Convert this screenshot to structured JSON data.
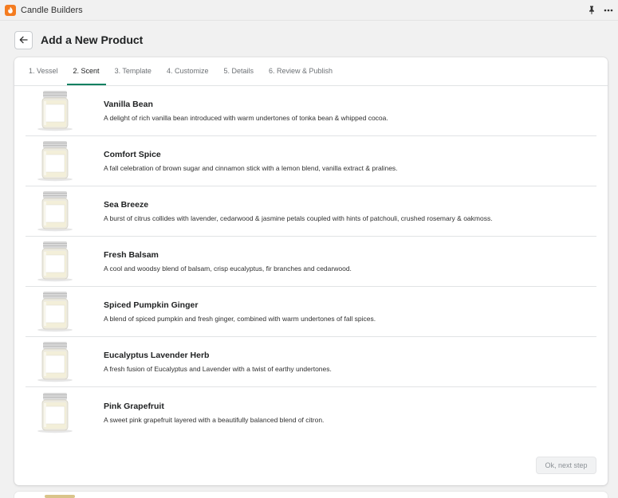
{
  "app": {
    "name": "Candle Builders",
    "accent": "#f47c20"
  },
  "page": {
    "title": "Add a New Product"
  },
  "tabs": [
    {
      "label": "1. Vessel",
      "active": false
    },
    {
      "label": "2. Scent",
      "active": true
    },
    {
      "label": "3. Template",
      "active": false
    },
    {
      "label": "4. Customize",
      "active": false
    },
    {
      "label": "5. Details",
      "active": false
    },
    {
      "label": "6. Review & Publish",
      "active": false
    }
  ],
  "scents": [
    {
      "name": "Vanilla Bean",
      "description": "A delight of rich vanilla bean introduced with warm undertones of tonka bean & whipped cocoa."
    },
    {
      "name": "Comfort Spice",
      "description": "A fall celebration of brown sugar and cinnamon stick with a lemon blend, vanilla extract & pralines."
    },
    {
      "name": "Sea Breeze",
      "description": "A burst of citrus collides with lavender, cedarwood & jasmine petals coupled with hints of patchouli, crushed rosemary & oakmoss."
    },
    {
      "name": "Fresh Balsam",
      "description": "A cool and woodsy blend of balsam, crisp eucalyptus, fir branches and cedarwood."
    },
    {
      "name": "Spiced Pumpkin Ginger",
      "description": "A blend of spiced pumpkin and fresh ginger, combined with warm undertones of fall spices."
    },
    {
      "name": "Eucalyptus Lavender Herb",
      "description": "A fresh fusion of Eucalyptus and Lavender with a twist of earthy undertones."
    },
    {
      "name": "Pink Grapefruit",
      "description": "A sweet pink grapefruit layered with a beautifully balanced blend of citron."
    }
  ],
  "actions": {
    "next_label": "Ok, next step"
  },
  "colors": {
    "tab_active_underline": "#008060",
    "jar_wax": "#f3efd9",
    "jar_lid": "#d8d8d8"
  },
  "icons": {
    "app_logo": "flame-icon",
    "pin": "pin-icon",
    "more": "more-icon",
    "back": "arrow-left-icon"
  }
}
